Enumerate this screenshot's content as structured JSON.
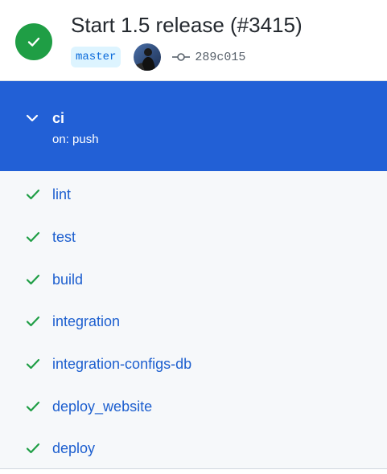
{
  "run": {
    "title": "Start 1.5 release (#3415)",
    "branch": "master",
    "commit_sha": "289c015",
    "status": "success",
    "colors": {
      "success": "#1f9e45",
      "branch_text": "#0969da",
      "branch_bg": "#ddf4ff"
    }
  },
  "workflow": {
    "name": "ci",
    "trigger": "on: push",
    "expanded": true,
    "colors": {
      "background": "#2260d6",
      "text": "#ffffff"
    }
  },
  "jobs": [
    {
      "label": "lint",
      "status": "success"
    },
    {
      "label": "test",
      "status": "success"
    },
    {
      "label": "build",
      "status": "success"
    },
    {
      "label": "integration",
      "status": "success"
    },
    {
      "label": "integration-configs-db",
      "status": "success"
    },
    {
      "label": "deploy_website",
      "status": "success"
    },
    {
      "label": "deploy",
      "status": "success"
    }
  ],
  "icons": {
    "status": "check-circle-icon",
    "avatar": "user-avatar",
    "commit": "git-commit-icon",
    "workflow_toggle": "chevron-down-icon",
    "job_status": "check-icon"
  }
}
